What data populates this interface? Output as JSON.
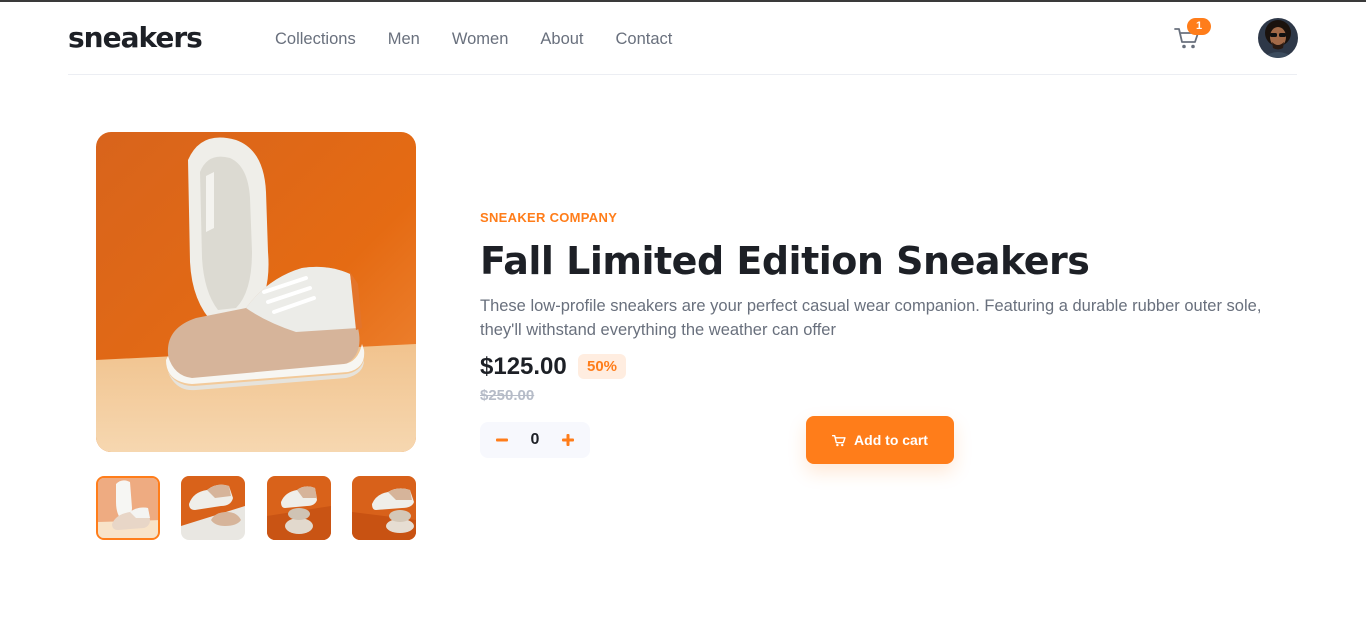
{
  "header": {
    "logo": "sneakers",
    "nav": [
      "Collections",
      "Men",
      "Women",
      "About",
      "Contact"
    ],
    "cart_count": "1",
    "cart_icon": "cart-icon",
    "avatar_icon": "user-avatar"
  },
  "gallery": {
    "active_thumbnail": 1,
    "thumbnail_count": 4
  },
  "product": {
    "company": "SNEAKER COMPANY",
    "title": "Fall Limited Edition Sneakers",
    "description": "These low-profile sneakers are your perfect casual wear companion. Featuring a durable rubber outer sole, they'll withstand everything the weather can offer",
    "price": "$125.00",
    "discount": "50%",
    "original_price": "$250.00"
  },
  "cart_controls": {
    "quantity": "0",
    "minus_icon": "minus-icon",
    "plus_icon": "plus-icon",
    "add_label": "Add to cart"
  },
  "colors": {
    "accent": "#ff7d1a",
    "accent_pale": "#ffede0",
    "text_dark": "#1d2026",
    "text_grey": "#69707d"
  }
}
